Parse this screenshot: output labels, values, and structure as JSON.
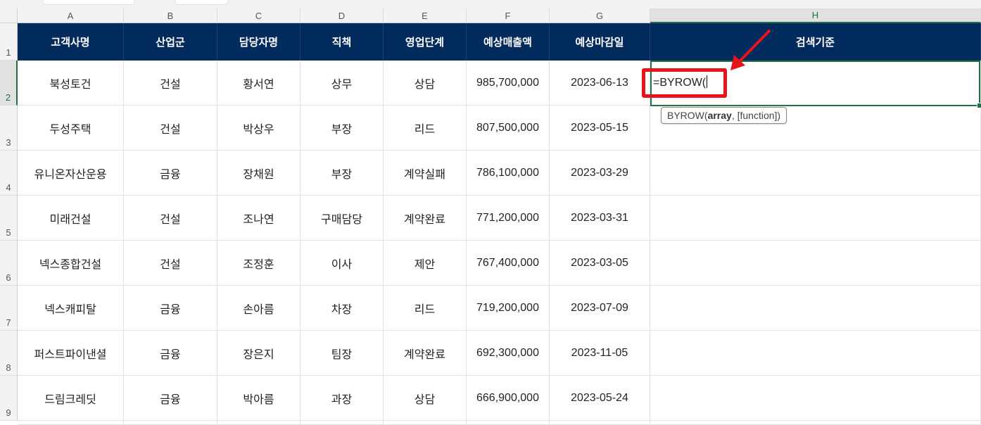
{
  "columns": [
    "A",
    "B",
    "C",
    "D",
    "E",
    "F",
    "G",
    "H"
  ],
  "rows": [
    "1",
    "2",
    "3",
    "4",
    "5",
    "6",
    "7",
    "8",
    "9"
  ],
  "selected_column": "H",
  "selected_row": "2",
  "header": [
    "고객사명",
    "산업군",
    "담당자명",
    "직책",
    "영업단계",
    "예상매출액",
    "예상마감일",
    "검색기준"
  ],
  "data": [
    [
      "북성토건",
      "건설",
      "황서연",
      "상무",
      "상담",
      "985,700,000",
      "2023-06-13"
    ],
    [
      "두성주택",
      "건설",
      "박상우",
      "부장",
      "리드",
      "807,500,000",
      "2023-05-15"
    ],
    [
      "유니온자산운용",
      "금융",
      "장채원",
      "부장",
      "계약실패",
      "786,100,000",
      "2023-03-29"
    ],
    [
      "미래건설",
      "건설",
      "조나연",
      "구매담당",
      "계약완료",
      "771,200,000",
      "2023-03-31"
    ],
    [
      "넥스종합건설",
      "건설",
      "조정훈",
      "이사",
      "제안",
      "767,400,000",
      "2023-03-05"
    ],
    [
      "넥스캐피탈",
      "금융",
      "손아름",
      "차장",
      "리드",
      "719,200,000",
      "2023-07-09"
    ],
    [
      "퍼스트파이낸셜",
      "금융",
      "장은지",
      "팀장",
      "계약완료",
      "692,300,000",
      "2023-11-05"
    ],
    [
      "드림크레딧",
      "금융",
      "박아름",
      "과장",
      "상담",
      "666,900,000",
      "2023-05-24"
    ]
  ],
  "editing": {
    "formula": "=BYROW(",
    "tooltip_func": "BYROW(",
    "tooltip_arg1": "array",
    "tooltip_rest": ", [function])"
  },
  "colors": {
    "header_bg": "#002b5c",
    "highlight": "#e8141c",
    "selection": "#217346"
  }
}
